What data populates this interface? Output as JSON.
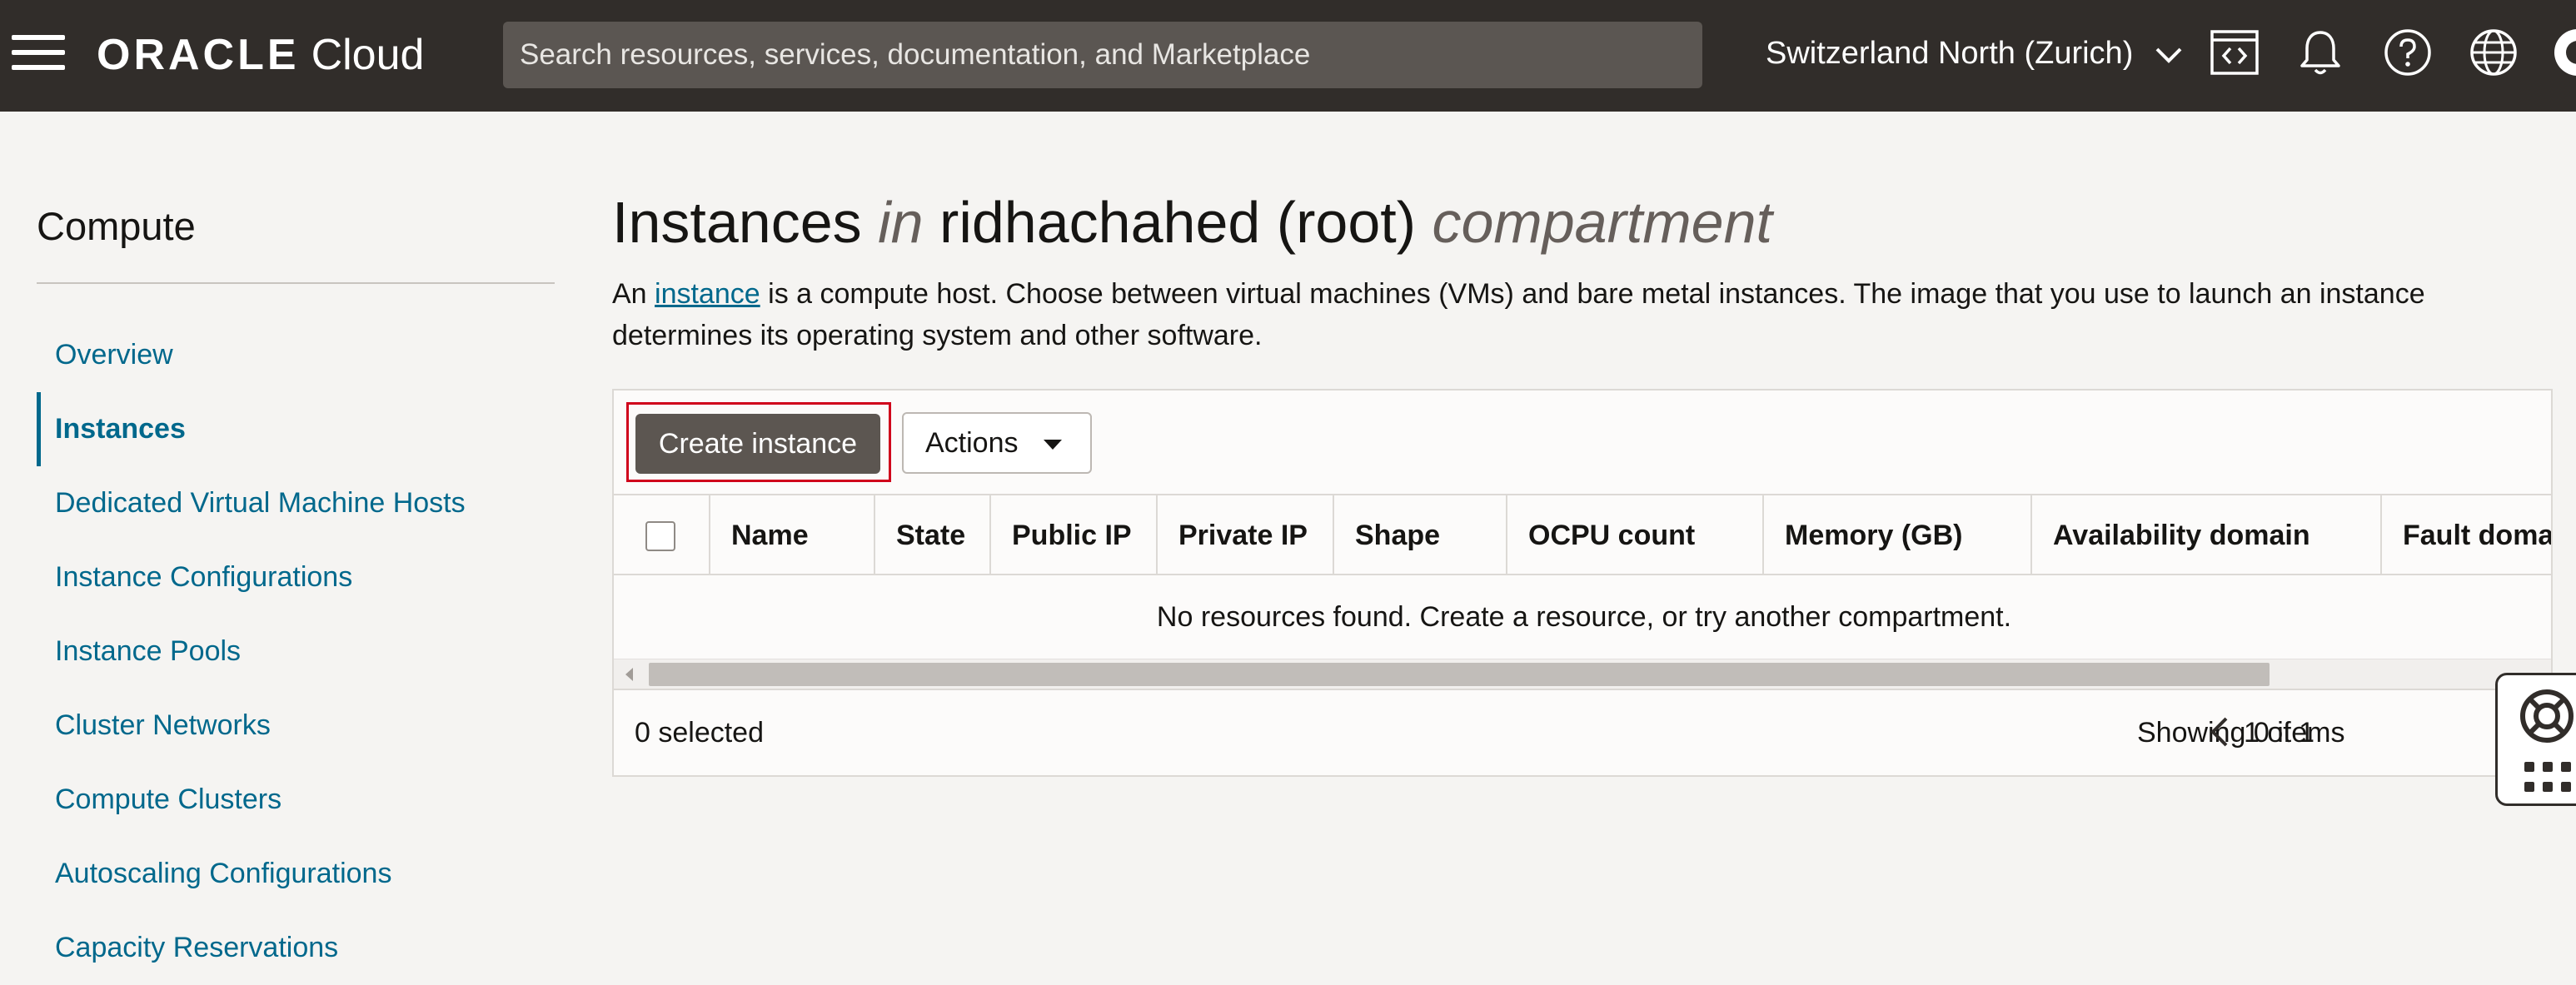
{
  "header": {
    "brand_oracle": "ORACLE",
    "brand_cloud": "Cloud",
    "search_placeholder": "Search resources, services, documentation, and Marketplace",
    "region": "Switzerland North (Zurich)",
    "icons": [
      "code-editor-icon",
      "notifications-bell-icon",
      "help-icon",
      "language-globe-icon",
      "profile-icon"
    ]
  },
  "sidebar": {
    "title": "Compute",
    "items": [
      {
        "label": "Overview"
      },
      {
        "label": "Instances",
        "active": true
      },
      {
        "label": "Dedicated Virtual Machine Hosts"
      },
      {
        "label": "Instance Configurations"
      },
      {
        "label": "Instance Pools"
      },
      {
        "label": "Cluster Networks"
      },
      {
        "label": "Compute Clusters"
      },
      {
        "label": "Autoscaling Configurations"
      },
      {
        "label": "Capacity Reservations"
      }
    ]
  },
  "main": {
    "title_main": "Instances",
    "title_in": "in",
    "title_compartment_name": "ridhachahed (root)",
    "title_compartment_word": "compartment",
    "description_before": "An ",
    "description_link": "instance",
    "description_after": " is a compute host. Choose between virtual machines (VMs) and bare metal instances. The image that you use to launch an instance determines its operating system and other software.",
    "create_button": "Create instance",
    "actions_button": "Actions",
    "table": {
      "columns": [
        "Name",
        "State",
        "Public IP",
        "Private IP",
        "Shape",
        "OCPU count",
        "Memory (GB)",
        "Availability domain",
        "Fault domain"
      ],
      "empty_message": "No resources found. Create a resource, or try another compartment.",
      "selected_count": "0 selected",
      "showing": "Showing 0 items",
      "page": "1 of 1"
    }
  },
  "colors": {
    "header_bg": "#312d2a",
    "link": "#00688c",
    "primary_button": "#5c5651",
    "focus_outline": "#d0021b"
  }
}
